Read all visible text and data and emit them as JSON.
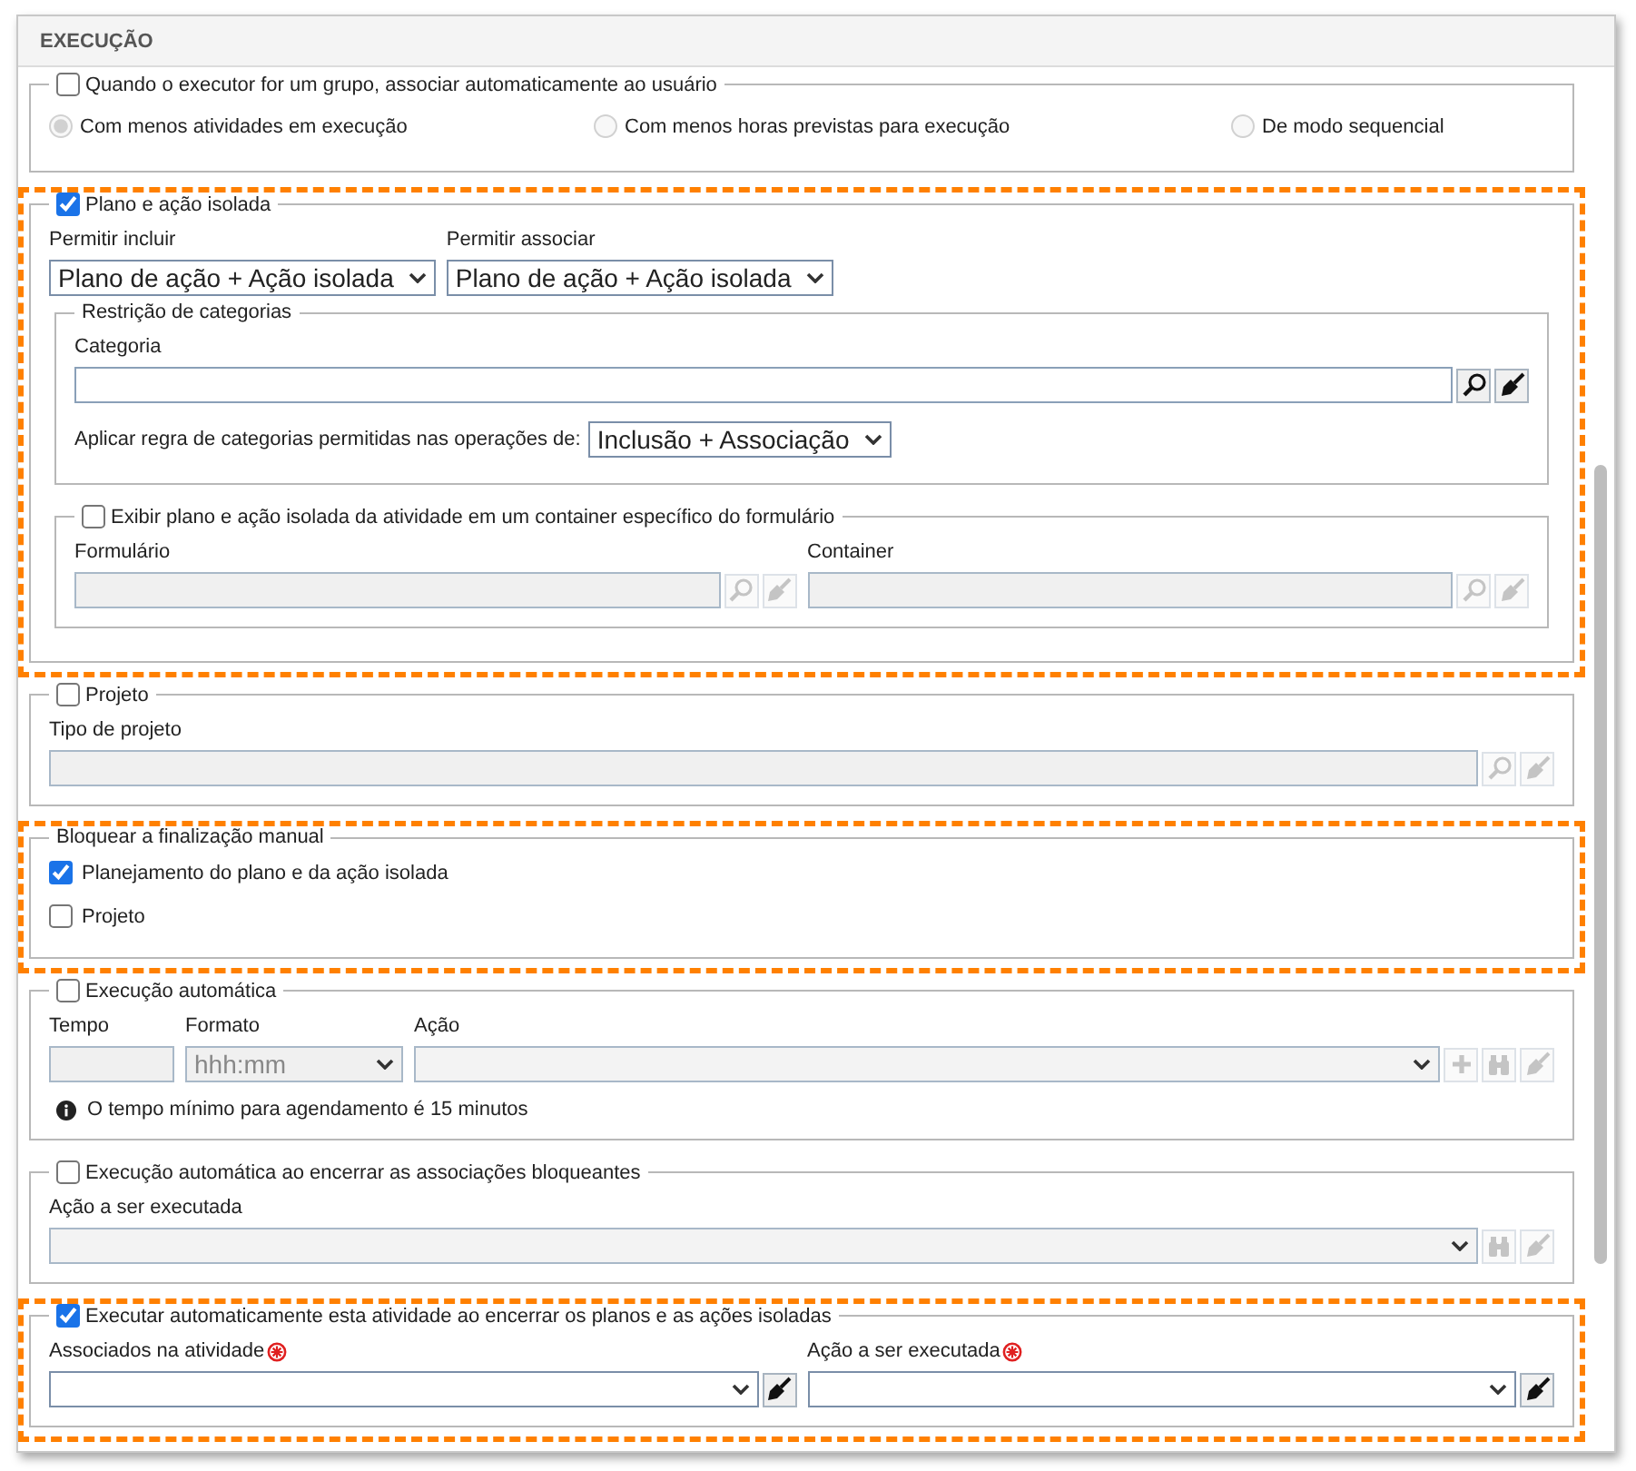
{
  "panel": {
    "title": "EXECUÇÃO"
  },
  "sections": [
    {
      "title": "Quando o executor for um grupo, associar automaticamente ao usuário",
      "checked": false,
      "highlighted": false,
      "rows": [
        {
          "kind": "radios",
          "options": [
            {
              "label": "Com menos atividades em execução",
              "selected": true,
              "disabled": true
            },
            {
              "label": "Com menos horas previstas para execução",
              "selected": false,
              "disabled": true
            },
            {
              "label": "De modo sequencial",
              "selected": false,
              "disabled": true
            }
          ]
        }
      ]
    },
    {
      "title": "Plano e ação isolada",
      "checked": true,
      "highlighted": true,
      "rows": [
        {
          "kind": "fields",
          "fields": [
            {
              "kind": "dropdown",
              "label": "Permitir incluir",
              "value": "Plano de ação + Ação isolada",
              "disabled": false
            },
            {
              "kind": "dropdown",
              "label": "Permitir associar",
              "value": "Plano de ação + Ação isolada",
              "disabled": false
            }
          ]
        },
        {
          "kind": "section",
          "section": {
            "title": "Restrição de categorias",
            "rows": [
              {
                "kind": "fields",
                "fields": [
                  {
                    "kind": "lookup",
                    "label": "Categoria",
                    "disabled": false,
                    "buttons": [
                      {
                        "kind": "search",
                        "disabled": false
                      },
                      {
                        "kind": "clear",
                        "disabled": false
                      }
                    ]
                  }
                ]
              },
              {
                "kind": "inline-select",
                "label": "Aplicar regra de categorias permitidas nas operações de:",
                "value": "Inclusão + Associação",
                "disabled": false
              }
            ]
          }
        },
        {
          "kind": "section",
          "section": {
            "title": "Exibir plano e ação isolada da atividade em um container específico do formulário",
            "checked": false,
            "rows": [
              {
                "kind": "fields",
                "fields": [
                  {
                    "kind": "lookup",
                    "label": "Formulário",
                    "disabled": true,
                    "buttons": [
                      {
                        "kind": "search",
                        "disabled": true
                      },
                      {
                        "kind": "clear",
                        "disabled": true
                      }
                    ]
                  },
                  {
                    "kind": "lookup",
                    "label": "Container",
                    "disabled": true,
                    "buttons": [
                      {
                        "kind": "search",
                        "disabled": true
                      },
                      {
                        "kind": "clear",
                        "disabled": true
                      }
                    ]
                  }
                ]
              }
            ]
          }
        }
      ]
    },
    {
      "title": "Projeto",
      "checked": false,
      "highlighted": false,
      "rows": [
        {
          "kind": "fields",
          "fields": [
            {
              "kind": "lookup",
              "label": "Tipo de projeto",
              "disabled": true,
              "buttons": [
                {
                  "kind": "search",
                  "disabled": true
                },
                {
                  "kind": "clear",
                  "disabled": true
                }
              ]
            }
          ]
        }
      ]
    },
    {
      "title": "Bloquear a finalização manual",
      "highlighted": true,
      "rows": [
        {
          "kind": "checkbox",
          "label": "Planejamento do plano e da ação isolada",
          "checked": true
        },
        {
          "kind": "checkbox",
          "label": "Projeto",
          "checked": false
        }
      ]
    },
    {
      "title": "Execução automática",
      "checked": false,
      "highlighted": false,
      "rows": [
        {
          "kind": "fields",
          "fields": [
            {
              "kind": "short",
              "label": "Tempo",
              "disabled": true
            },
            {
              "kind": "dropdown",
              "label": "Formato",
              "value": "hhh:mm",
              "disabled": true
            },
            {
              "kind": "combo",
              "label": "Ação",
              "disabled": true,
              "buttons": [
                {
                  "kind": "add",
                  "disabled": true
                },
                {
                  "kind": "binoculars",
                  "disabled": true
                },
                {
                  "kind": "clear",
                  "disabled": true
                }
              ]
            }
          ]
        },
        {
          "kind": "note",
          "text": "O tempo mínimo para agendamento é 15 minutos"
        }
      ]
    },
    {
      "title": "Execução automática ao encerrar as associações bloqueantes",
      "checked": false,
      "highlighted": false,
      "rows": [
        {
          "kind": "fields",
          "fields": [
            {
              "kind": "combo",
              "label": "Ação a ser executada",
              "disabled": true,
              "buttons": [
                {
                  "kind": "binoculars",
                  "disabled": true
                },
                {
                  "kind": "clear",
                  "disabled": true
                }
              ]
            }
          ]
        }
      ]
    },
    {
      "title": "Executar automaticamente esta atividade ao encerrar os planos e as ações isoladas",
      "checked": true,
      "highlighted": true,
      "rows": [
        {
          "kind": "fields",
          "fields": [
            {
              "kind": "combo",
              "label": "Associados na atividade",
              "required": true,
              "disabled": false,
              "buttons": [
                {
                  "kind": "clear",
                  "disabled": false
                }
              ]
            },
            {
              "kind": "combo",
              "label": "Ação a ser executada",
              "required": true,
              "disabled": false,
              "buttons": [
                {
                  "kind": "clear",
                  "disabled": false
                }
              ]
            }
          ]
        }
      ]
    }
  ]
}
